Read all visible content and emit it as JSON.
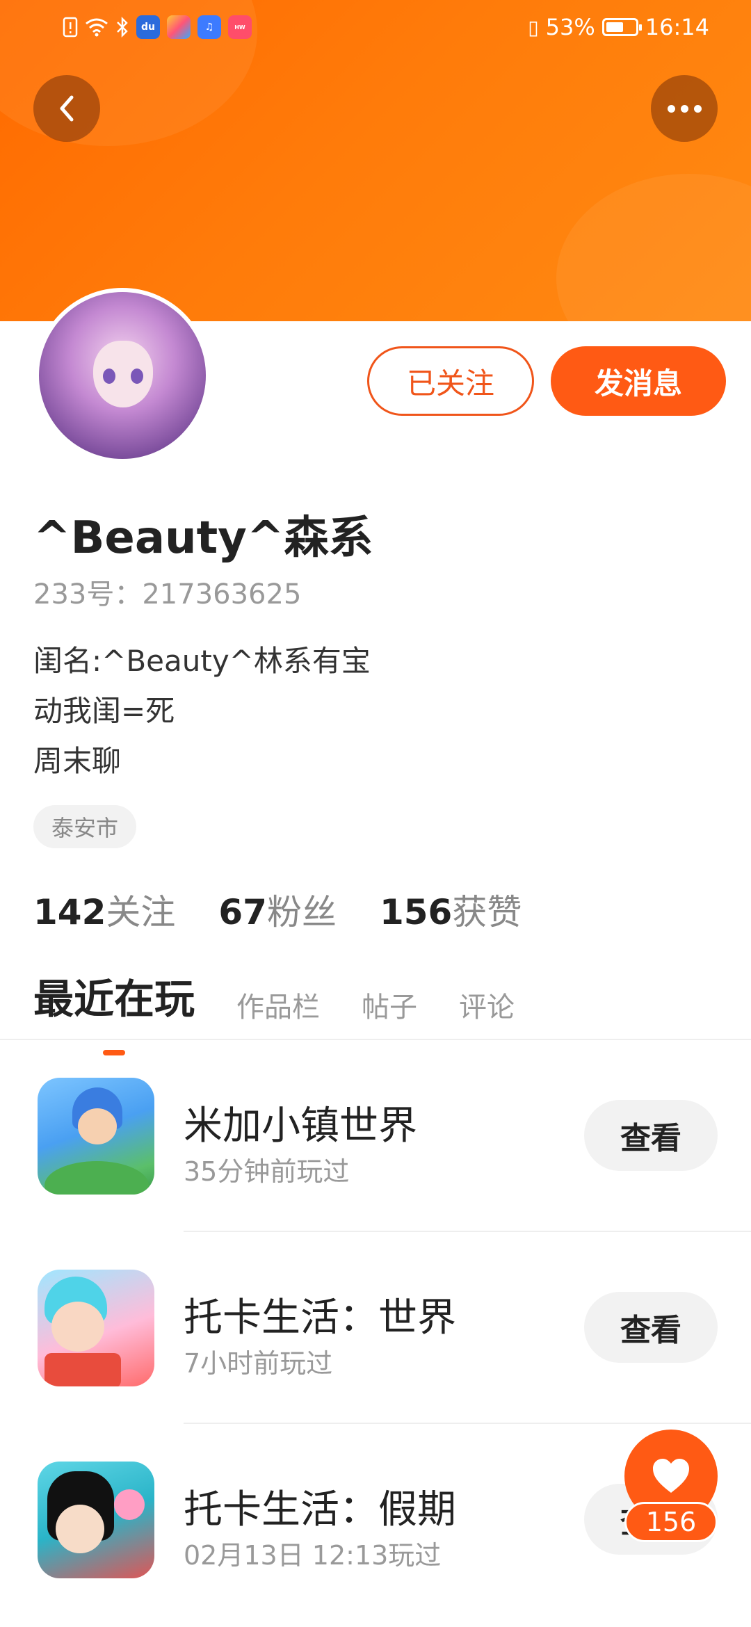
{
  "status_bar": {
    "battery": "53%",
    "time": "16:14",
    "battery_level": 0.53
  },
  "profile": {
    "follow_button": "已关注",
    "message_button": "发消息",
    "name": "^Beauty^森系",
    "id_label": "233号：217363625",
    "bio": [
      "闺名:^Beauty^林系有宝",
      "动我闺=死",
      "周末聊"
    ],
    "location": "泰安市"
  },
  "stats": [
    {
      "value": "142",
      "label": "关注"
    },
    {
      "value": "67",
      "label": "粉丝"
    },
    {
      "value": "156",
      "label": "获赞"
    }
  ],
  "tabs": [
    "最近在玩",
    "作品栏",
    "帖子",
    "评论"
  ],
  "games": [
    {
      "title": "米加小镇世界",
      "subtitle": "35分钟前玩过",
      "button": "查看"
    },
    {
      "title": "托卡生活：世界",
      "subtitle": "7小时前玩过",
      "button": "查看"
    },
    {
      "title": "托卡生活：假期",
      "subtitle": "02月13日 12:13玩过",
      "button": "查看"
    }
  ],
  "fab": {
    "count": "156"
  },
  "colors": {
    "accent": "#ff5a14",
    "header": "#ff7b0a"
  }
}
